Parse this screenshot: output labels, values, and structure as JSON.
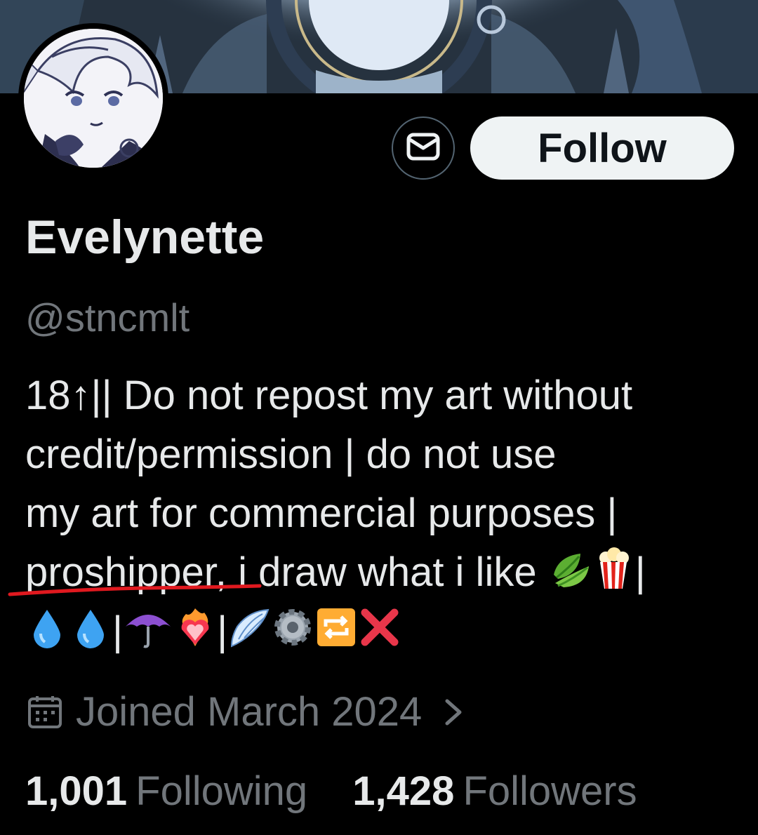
{
  "profile": {
    "display_name": "Evelynette",
    "handle": "@stncmlt",
    "follow_label": "Follow",
    "message_icon": "envelope-icon"
  },
  "bio": {
    "line1": "18↑|| Do not repost my art without",
    "line2": "credit/permission | do not use",
    "line3": "my art for commercial purposes |",
    "line4_underlined": "proshipper,",
    "line4_rest": " i draw what i like ",
    "line4_end": "|",
    "line5_sep1": "|",
    "line5_sep2": "|",
    "emojis": [
      "leaf-emoji",
      "popcorn-emoji",
      "droplet-emoji",
      "droplet-emoji",
      "umbrella-emoji",
      "heart-on-fire-emoji",
      "wing-emoji",
      "gear-emoji",
      "repeat-emoji",
      "cross-mark-emoji"
    ]
  },
  "joined": {
    "text": "Joined March 2024",
    "icon": "calendar-icon"
  },
  "stats": {
    "following_count": "1,001",
    "following_label": "Following",
    "followers_count": "1,428",
    "followers_label": "Followers"
  },
  "colors": {
    "background": "#000000",
    "primary_text": "#e7e9ea",
    "secondary_text": "#71767b",
    "button_bg": "#eff3f4",
    "annotation_red": "#e0191f"
  }
}
